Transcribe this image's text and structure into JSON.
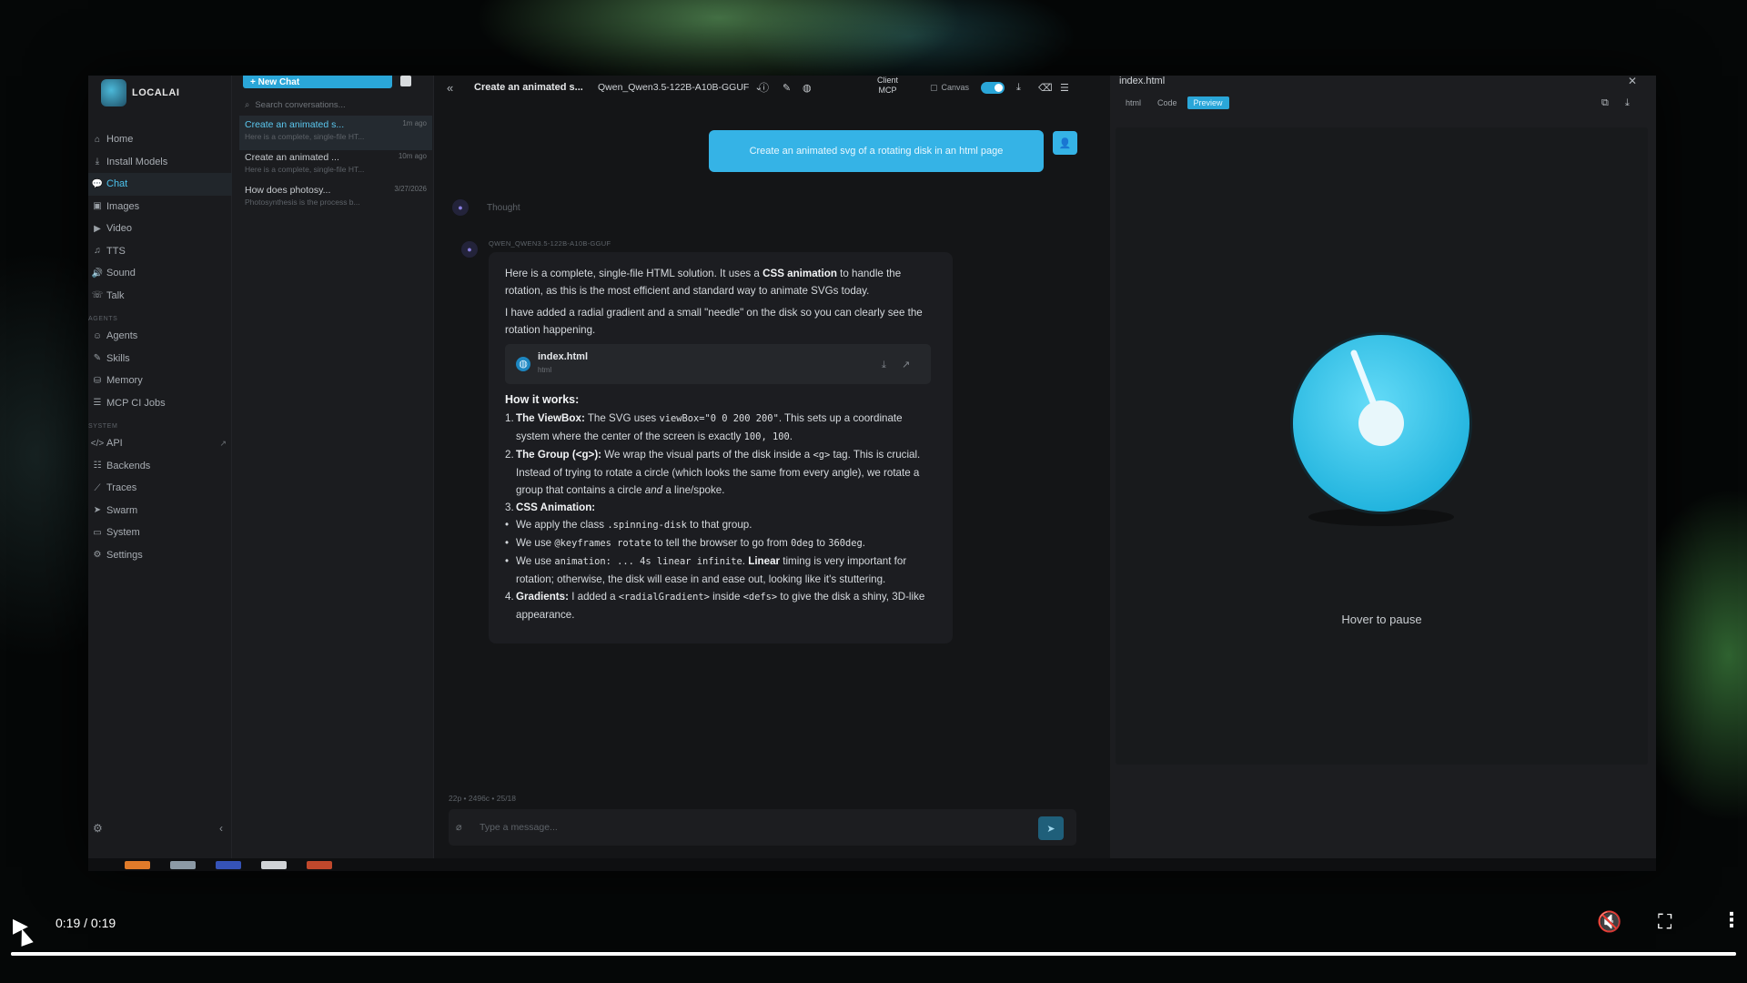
{
  "app": {
    "logo_text": "LOCALAI",
    "sidebar": {
      "items": [
        {
          "label": "Home",
          "icon": "home-icon",
          "glyph": "⌂"
        },
        {
          "label": "Install Models",
          "icon": "download-icon",
          "glyph": "⤓"
        },
        {
          "label": "Chat",
          "icon": "chat-icon",
          "glyph": "💬",
          "active": true
        },
        {
          "label": "Images",
          "icon": "image-icon",
          "glyph": "▣"
        },
        {
          "label": "Video",
          "icon": "video-icon",
          "glyph": "▶"
        },
        {
          "label": "TTS",
          "icon": "music-icon",
          "glyph": "♫"
        },
        {
          "label": "Sound",
          "icon": "speaker-icon",
          "glyph": "🔊"
        },
        {
          "label": "Talk",
          "icon": "phone-icon",
          "glyph": "☏"
        }
      ],
      "section_agents": "AGENTS",
      "agents_items": [
        {
          "label": "Agents",
          "icon": "robot-icon",
          "glyph": "☺"
        },
        {
          "label": "Skills",
          "icon": "wand-icon",
          "glyph": "✎"
        },
        {
          "label": "Memory",
          "icon": "database-icon",
          "glyph": "⛁"
        },
        {
          "label": "MCP CI Jobs",
          "icon": "list-icon",
          "glyph": "☰"
        }
      ],
      "section_system": "SYSTEM",
      "system_items": [
        {
          "label": "API",
          "icon": "code-icon",
          "glyph": "</>",
          "external": "↗"
        },
        {
          "label": "Backends",
          "icon": "server-icon",
          "glyph": "☷"
        },
        {
          "label": "Traces",
          "icon": "chart-icon",
          "glyph": "⟋"
        },
        {
          "label": "Swarm",
          "icon": "send-icon",
          "glyph": "➤"
        },
        {
          "label": "System",
          "icon": "monitor-icon",
          "glyph": "▭"
        },
        {
          "label": "Settings",
          "icon": "gear-icon",
          "glyph": "⚙"
        }
      ]
    },
    "conversations": {
      "new_chat_label": "+ New Chat",
      "search_placeholder": "Search conversations...",
      "items": [
        {
          "title": "Create an animated s...",
          "time": "1m ago",
          "preview": "Here is a complete, single-file HT...",
          "active": true
        },
        {
          "title": "Create an animated ...",
          "time": "10m ago",
          "preview": "Here is a complete, single-file HT...",
          "active": false
        },
        {
          "title": "How does photosy...",
          "time": "3/27/2026",
          "preview": "Photosynthesis is the process b...",
          "active": false
        }
      ]
    },
    "chat": {
      "title": "Create an animated s...",
      "model": "Qwen_Qwen3.5-122B-A10B-GGUF",
      "mcp_line1": "Client",
      "mcp_line2": "MCP",
      "canvas_label": "Canvas",
      "canvas_on": true,
      "user_message": "Create an animated svg of a rotating disk in an html page",
      "thought_label": "Thought",
      "model_tag": "QWEN_QWEN3.5-122B-A10B-GGUF",
      "answer": {
        "p1_a": "Here is a complete, single-file HTML solution. It uses a ",
        "p1_b": "CSS animation",
        "p1_c": " to handle the rotation, as this is the most efficient and standard way to animate SVGs today.",
        "p2": "I have added a radial gradient and a small \"needle\" on the disk so you can clearly see the rotation happening.",
        "file_name": "index.html",
        "file_type": "html",
        "how_title": "How it works:",
        "s1_b": "The ViewBox:",
        "s1_t1": " The SVG uses ",
        "s1_c1": "viewBox=\"0 0 200 200\"",
        "s1_t2": ". This sets up a coordinate system where the center of the screen is exactly ",
        "s1_c2": "100, 100",
        "s1_t3": ".",
        "s2_b": "The Group (<g>):",
        "s2_t1": " We wrap the visual parts of the disk inside a ",
        "s2_c1": "<g>",
        "s2_t2": " tag. This is crucial. Instead of trying to rotate a circle (which looks the same from every angle), we rotate a group that contains a circle ",
        "s2_i": "and",
        "s2_t3": " a line/spoke.",
        "s3_b": "CSS Animation:",
        "s3_l1_a": "We apply the class ",
        "s3_l1_c": ".spinning-disk",
        "s3_l1_b": " to that group.",
        "s3_l2_a": "We use ",
        "s3_l2_c": "@keyframes rotate",
        "s3_l2_b": " to tell the browser to go from ",
        "s3_l2_c2": "0deg",
        "s3_l2_d": " to ",
        "s3_l2_c3": "360deg",
        "s3_l2_e": ".",
        "s3_l3_a": "We use ",
        "s3_l3_c": "animation: ... 4s linear infinite",
        "s3_l3_b": ". ",
        "s3_l3_bold": "Linear",
        "s3_l3_d": " timing is very important for rotation; otherwise, the disk will ease in and ease out, looking like it's stuttering.",
        "s4_b": "Gradients:",
        "s4_t1": " I added a ",
        "s4_c1": "<radialGradient>",
        "s4_t2": " inside ",
        "s4_c2": "<defs>",
        "s4_t3": " to give the disk a shiny, 3D-like appearance."
      },
      "stats": "22p • 2496c • 25/18",
      "composer_placeholder": "Type a message..."
    },
    "preview": {
      "file_title": "index.html",
      "tabs": [
        {
          "label": "html",
          "active": false
        },
        {
          "label": "Code",
          "active": false
        },
        {
          "label": "Preview",
          "active": true
        }
      ],
      "hover_label": "Hover to pause"
    }
  },
  "video": {
    "time": "0:19 / 0:19",
    "progress": 1.0
  },
  "colors": {
    "accent": "#2aa6d8",
    "disk": "#3ecbf0"
  }
}
